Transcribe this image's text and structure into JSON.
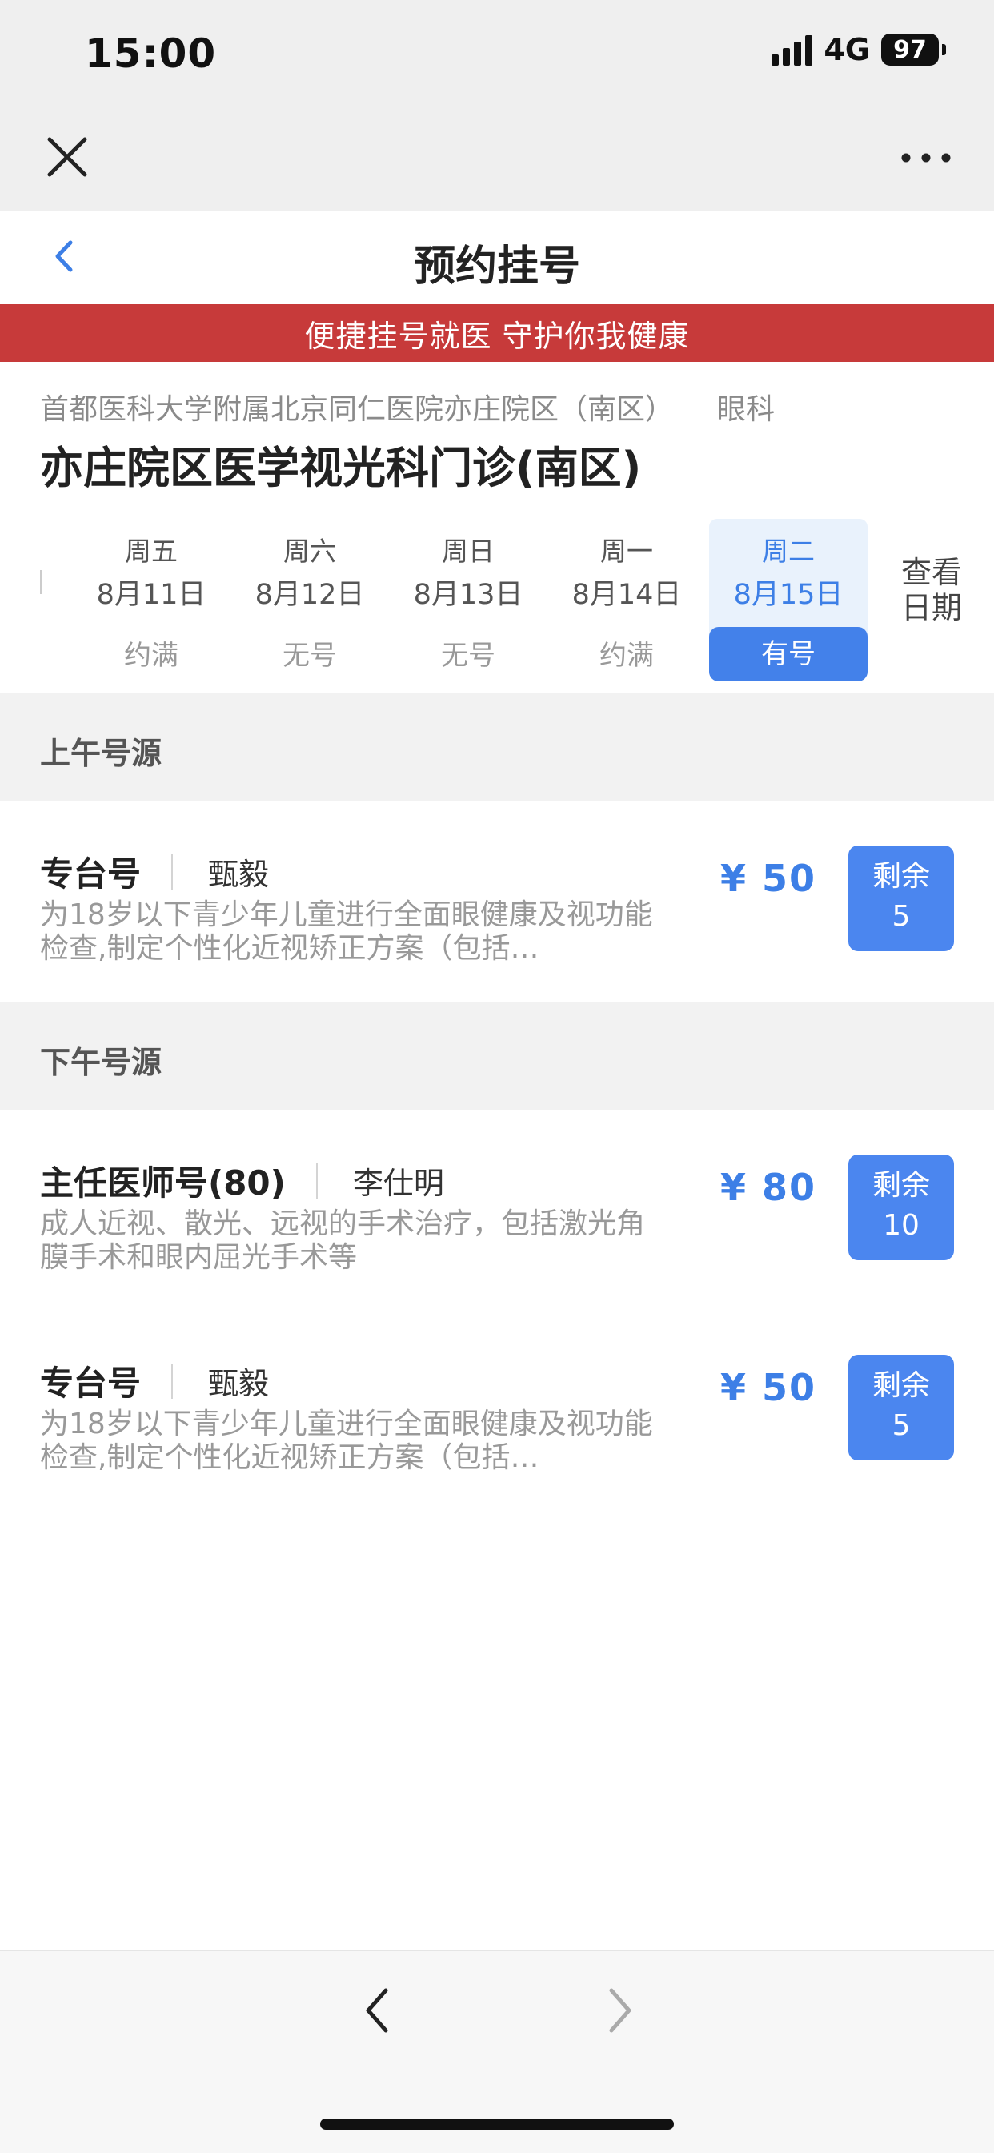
{
  "status_bar": {
    "time": "15:00",
    "network": "4G",
    "battery": "97"
  },
  "header": {
    "title": "预约挂号"
  },
  "banner": "便捷挂号就医 守护你我健康",
  "hospital": {
    "name": "首都医科大学附属北京同仁医院亦庄院区（南区）",
    "department": "眼科"
  },
  "clinic": "亦庄院区医学视光科门诊(南区)",
  "dates": [
    {
      "weekday": "周五",
      "date": "8月11日",
      "status": "约满"
    },
    {
      "weekday": "周六",
      "date": "8月12日",
      "status": "无号"
    },
    {
      "weekday": "周日",
      "date": "8月13日",
      "status": "无号"
    },
    {
      "weekday": "周一",
      "date": "8月14日",
      "status": "约满"
    },
    {
      "weekday": "周二",
      "date": "8月15日",
      "status": "有号"
    }
  ],
  "view_dates": "查看日期",
  "morning": {
    "title": "上午号源",
    "slots": [
      {
        "type": "专台号",
        "doctor": "甄毅",
        "desc": "为18岁以下青少年儿童进行全面眼健康及视功能检查,制定个性化近视矫正方案（包括…",
        "price": "¥ 50",
        "remain_label": "剩余",
        "remain": "5"
      }
    ]
  },
  "afternoon": {
    "title": "下午号源",
    "slots": [
      {
        "type": "主任医师号(80)",
        "doctor": "李仕明",
        "desc": "成人近视、散光、远视的手术治疗，包括激光角膜手术和眼内屈光手术等",
        "price": "¥ 80",
        "remain_label": "剩余",
        "remain": "10"
      },
      {
        "type": "专台号",
        "doctor": "甄毅",
        "desc": "为18岁以下青少年儿童进行全面眼健康及视功能检查,制定个性化近视矫正方案（包括…",
        "price": "¥ 50",
        "remain_label": "剩余",
        "remain": "5"
      }
    ]
  },
  "colors": {
    "accent": "#4381ea",
    "banner": "#c73a3a"
  }
}
